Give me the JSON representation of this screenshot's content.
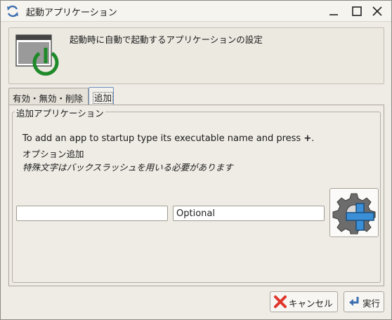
{
  "window": {
    "title": "起動アプリケーション",
    "icon": "refresh-icon",
    "controls": [
      "minimize-icon",
      "maximize-icon",
      "close-icon"
    ]
  },
  "header": {
    "icon": "power-window-icon",
    "text": "起動時に自動で起動するアプリケーションの設定"
  },
  "tabs": [
    {
      "label": "有効・無効・削除",
      "active": false
    },
    {
      "label": "追加",
      "active": true
    }
  ],
  "add_panel": {
    "group_title": "追加アプリケーション",
    "instruction_prefix": "To add an app to startup type its executable name and press ",
    "instruction_plus": "+",
    "instruction_suffix": ".",
    "options_text": "オプション追加",
    "note_text": "特殊文字はバックスラッシュを用いる必要があります",
    "command_input": {
      "value": "",
      "placeholder": ""
    },
    "optional_input": {
      "value": "Optional",
      "placeholder": ""
    },
    "add_button_icon": "gear-plus-icon"
  },
  "buttons": {
    "cancel_label": "キャンセル",
    "cancel_icon": "red-x-icon",
    "run_label": "実行",
    "run_icon": "enter-arrow-icon"
  },
  "colors": {
    "power_green": "#1f8a2a",
    "plus_blue": "#3b8fd6",
    "cancel_red": "#e0352b",
    "gear_gray": "#6c6c6c"
  }
}
